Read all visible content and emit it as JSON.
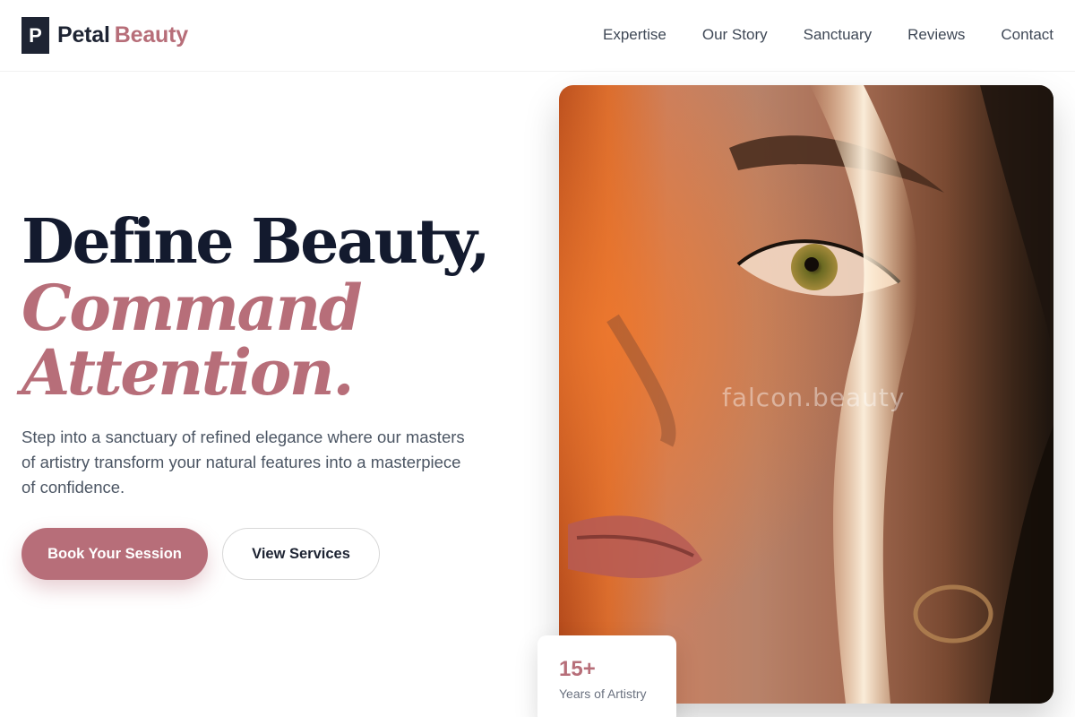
{
  "brand": {
    "logo_letter": "P",
    "name_first": "Petal",
    "name_second": "Beauty",
    "accent_color": "#b76e79",
    "dark_color": "#1e2433"
  },
  "nav": {
    "items": [
      {
        "label": "Expertise"
      },
      {
        "label": "Our Story"
      },
      {
        "label": "Sanctuary"
      },
      {
        "label": "Reviews"
      },
      {
        "label": "Contact"
      }
    ]
  },
  "hero": {
    "headline_line1": "Define Beauty,",
    "headline_line2": "Command",
    "headline_line3": "Attention.",
    "lead": "Step into a sanctuary of refined elegance where our masters of artistry transform your natural features into a masterpiece of confidence.",
    "primary_cta": "Book Your Session",
    "secondary_cta": "View Services"
  },
  "photo": {
    "watermark": "falcon.beauty"
  },
  "stat": {
    "value": "15+",
    "label": "Years of Artistry"
  }
}
